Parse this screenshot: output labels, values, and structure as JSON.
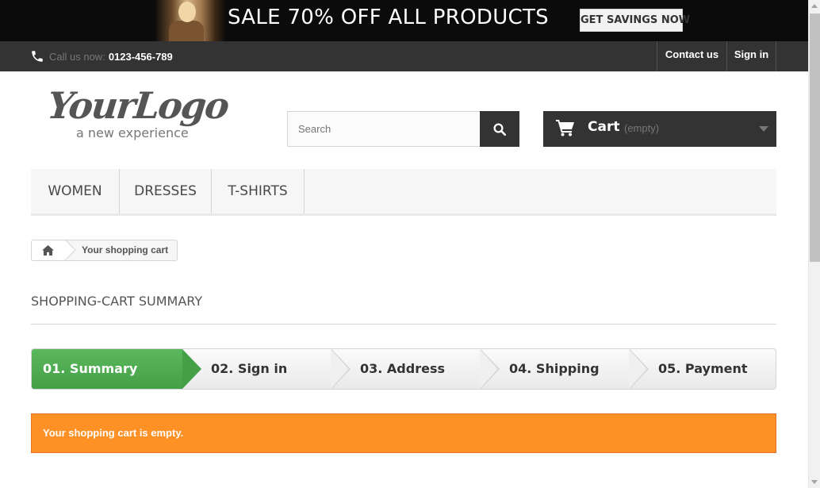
{
  "banner": {
    "text": "SALE 70% OFF ALL PRODUCTS",
    "button_label": "GET SAVINGS NOW"
  },
  "topbar": {
    "call_label": "Call us now:",
    "phone": "0123-456-789",
    "contact_label": "Contact us",
    "signin_label": "Sign in"
  },
  "logo": {
    "main": "YourLogo",
    "tagline": "a new experience"
  },
  "search": {
    "placeholder": "Search",
    "value": ""
  },
  "cart": {
    "label": "Cart",
    "status": "(empty)"
  },
  "menu": {
    "items": [
      "WOMEN",
      "DRESSES",
      "T-SHIRTS"
    ]
  },
  "breadcrumb": {
    "current": "Your shopping cart"
  },
  "page": {
    "heading": "SHOPPING-CART SUMMARY",
    "alert": "Your shopping cart is empty."
  },
  "steps": [
    {
      "label": "01. Summary",
      "active": true
    },
    {
      "label": "02. Sign in",
      "active": false
    },
    {
      "label": "03. Address",
      "active": false
    },
    {
      "label": "04. Shipping",
      "active": false
    },
    {
      "label": "05. Payment",
      "active": false
    }
  ],
  "colors": {
    "dark": "#333333",
    "active_step": "#43a047",
    "alert": "#fe9126"
  }
}
